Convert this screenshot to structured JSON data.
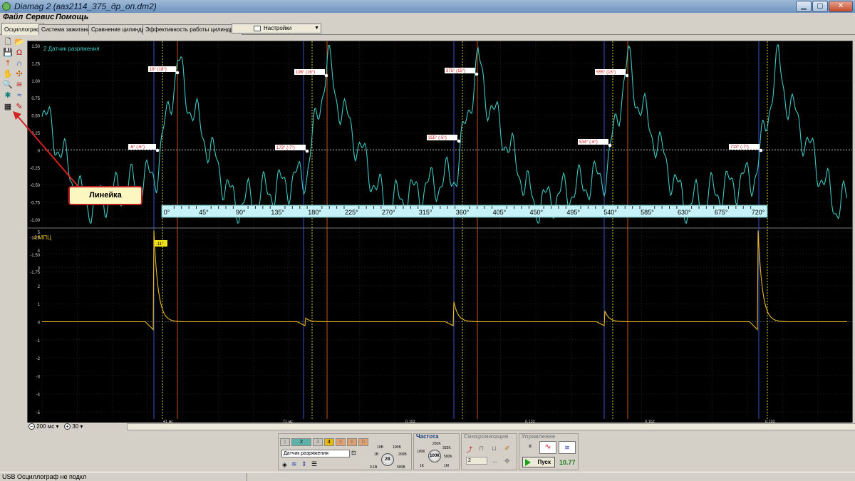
{
  "window": {
    "title": "Diamag 2 (ваз2114_375_др_оп.dm2)"
  },
  "menu": [
    {
      "label": "Файл"
    },
    {
      "label": "Сервис"
    },
    {
      "label": "Помощь"
    }
  ],
  "tabs": [
    {
      "label": "Осциллограф",
      "active": true
    },
    {
      "label": "Система зажигания"
    },
    {
      "label": "Сравнение цилиндров"
    },
    {
      "label": "Эффективность работы цилиндров"
    }
  ],
  "settings_dropdown": {
    "label": "Настройки"
  },
  "callout": {
    "label": "Линейка"
  },
  "channel_top": {
    "name": "2 Датчик разряжения",
    "color": "#3fc7c0",
    "y_ticks": [
      "1.50",
      "1.25",
      "1.00",
      "0.75",
      "0.50",
      "0.25",
      "0",
      "-0.25",
      "-0.50",
      "-0.75",
      "-1.00",
      "-1.25",
      "-1.50",
      "-1.75"
    ],
    "markers": [
      {
        "label": "-6° (-6°)"
      },
      {
        "label": "18° (18°)"
      },
      {
        "label": "173° (-7°)"
      },
      {
        "label": "196° (16°)"
      },
      {
        "label": "355° (-5°)"
      },
      {
        "label": "375° (15°)"
      },
      {
        "label": "534° (-6°)"
      },
      {
        "label": "555° (15°)"
      },
      {
        "label": "713° (-7°)"
      }
    ]
  },
  "ruler": {
    "labels": [
      "0°",
      "45°",
      "90°",
      "135°",
      "180°",
      "225°",
      "270°",
      "315°",
      "360°",
      "405°",
      "450°",
      "495°",
      "540°",
      "585°",
      "630°",
      "675°",
      "720°"
    ]
  },
  "channel_bottom": {
    "name": "4 МПЦ",
    "color": "#e8b923",
    "y_ticks": [
      "5",
      "4",
      "3",
      "2",
      "1",
      "0",
      "-1",
      "-2",
      "-3",
      "-4",
      "-5"
    ],
    "marker": {
      "label": "-11°"
    }
  },
  "time_axis": {
    "labels": [
      "41 мс",
      "71 мс",
      "0.102",
      "0.132",
      "0.162",
      "0.192"
    ]
  },
  "zoom": {
    "time_value": "200",
    "time_unit": "мс",
    "count_value": "30"
  },
  "channels_panel": {
    "buttons": [
      "1",
      "2",
      "3",
      "4",
      "5",
      "6",
      "D"
    ],
    "sensor": "Датчик разряжения",
    "knob_value": "2В",
    "knob_labels": [
      "1В",
      "10В",
      "100В",
      "200В",
      "500В",
      "0.1В"
    ]
  },
  "frequency_panel": {
    "title": "Частота",
    "knob_value": "100К",
    "knob_labels": [
      "100K",
      "250K",
      "333K",
      "500K",
      "1M",
      "1K"
    ]
  },
  "sync_panel": {
    "title": "Синхронизация",
    "channel": "2"
  },
  "control_panel": {
    "title": "Управление",
    "start_label": "Пуск",
    "fps": "10.77"
  },
  "status": {
    "text": "USB Осциллограф не подкл"
  }
}
